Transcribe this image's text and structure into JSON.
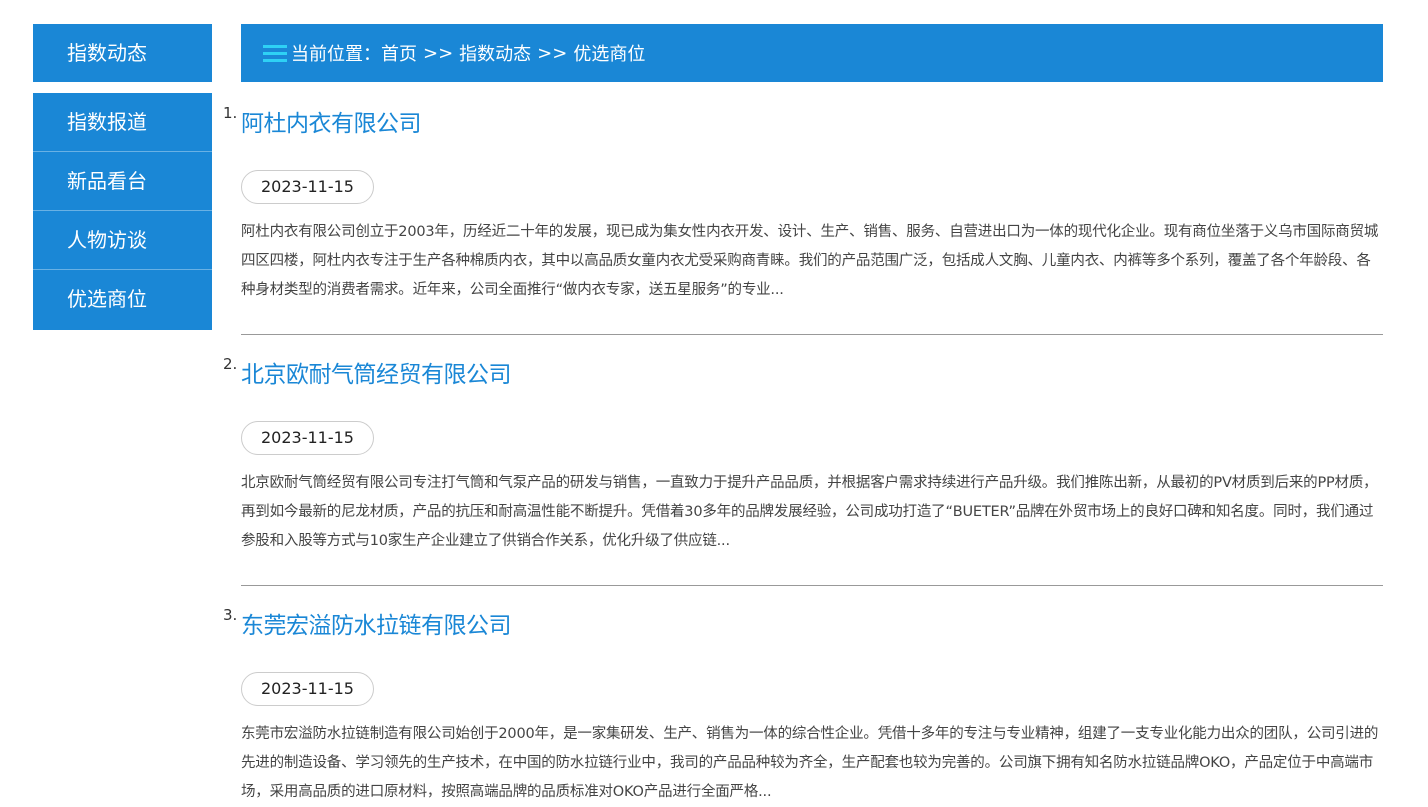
{
  "sidebar": {
    "title": "指数动态",
    "items": [
      {
        "label": "指数报道"
      },
      {
        "label": "新品看台"
      },
      {
        "label": "人物访谈"
      },
      {
        "label": "优选商位"
      }
    ]
  },
  "breadcrumb": {
    "prefix": "当前位置：",
    "home": "首页",
    "sep1": ">>",
    "section": "指数动态",
    "sep2": ">>",
    "current": "优选商位"
  },
  "articles": [
    {
      "num": "1.",
      "title": "阿杜内衣有限公司",
      "date": "2023-11-15",
      "desc": "阿杜内衣有限公司创立于2003年，历经近二十年的发展，现已成为集女性内衣开发、设计、生产、销售、服务、自营进出口为一体的现代化企业。现有商位坐落于义乌市国际商贸城四区四楼，阿杜内衣专注于生产各种棉质内衣，其中以高品质女童内衣尤受采购商青睐。我们的产品范围广泛，包括成人文胸、儿童内衣、内裤等多个系列，覆盖了各个年龄段、各种身材类型的消费者需求。近年来，公司全面推行“做内衣专家，送五星服务”的专业..."
    },
    {
      "num": "2.",
      "title": "北京欧耐气筒经贸有限公司",
      "date": "2023-11-15",
      "desc": "北京欧耐气筒经贸有限公司专注打气筒和气泵产品的研发与销售，一直致力于提升产品品质，并根据客户需求持续进行产品升级。我们推陈出新，从最初的PV材质到后来的PP材质，再到如今最新的尼龙材质，产品的抗压和耐高温性能不断提升。凭借着30多年的品牌发展经验，公司成功打造了“BUETER”品牌在外贸市场上的良好口碑和知名度。同时，我们通过参股和入股等方式与10家生产企业建立了供销合作关系，优化升级了供应链..."
    },
    {
      "num": "3.",
      "title": "东莞宏溢防水拉链有限公司",
      "date": "2023-11-15",
      "desc": "东莞市宏溢防水拉链制造有限公司始创于2000年，是一家集研发、生产、销售为一体的综合性企业。凭借十多年的专注与专业精神，组建了一支专业化能力出众的团队，公司引进的先进的制造设备、学习领先的生产技术，在中国的防水拉链行业中，我司的产品品种较为齐全，生产配套也较为完善的。公司旗下拥有知名防水拉链品牌OKO，产品定位于中高端市场，采用高品质的进口原材料，按照高端品牌的品质标准对OKO产品进行全面严格..."
    }
  ],
  "colors": {
    "accent": "#1a87d6",
    "icon": "#2ed1f5"
  },
  "icons": {
    "breadcrumb": "menu-icon"
  }
}
